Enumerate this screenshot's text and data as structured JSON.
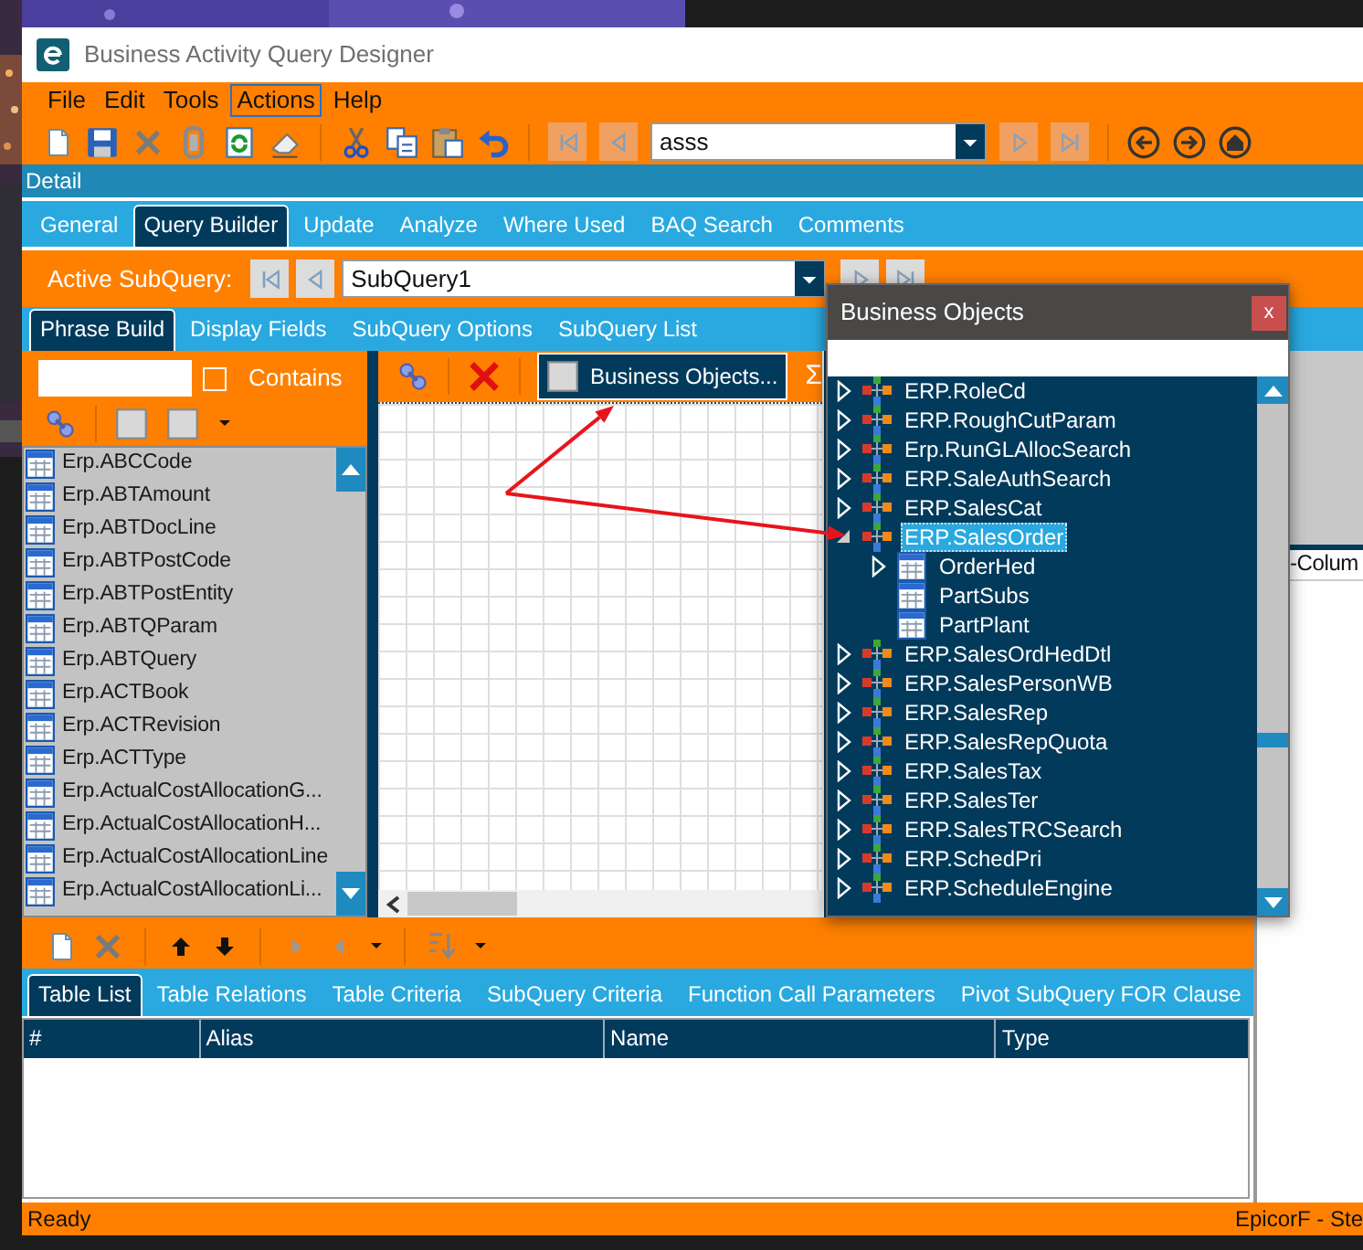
{
  "window": {
    "title": "Business Activity Query Designer"
  },
  "menu": [
    {
      "label": "File",
      "selected": false
    },
    {
      "label": "Edit",
      "selected": false
    },
    {
      "label": "Tools",
      "selected": false
    },
    {
      "label": "Actions",
      "selected": true
    },
    {
      "label": "Help",
      "selected": false
    }
  ],
  "toolbar": {
    "record_field": {
      "value": "asss"
    }
  },
  "detail_panel": {
    "title": "Detail"
  },
  "tabs": [
    {
      "label": "General",
      "selected": false
    },
    {
      "label": "Query Builder",
      "selected": true
    },
    {
      "label": "Update",
      "selected": false
    },
    {
      "label": "Analyze",
      "selected": false
    },
    {
      "label": "Where Used",
      "selected": false
    },
    {
      "label": "BAQ Search",
      "selected": false
    },
    {
      "label": "Comments",
      "selected": false
    }
  ],
  "active_subquery": {
    "label": "Active SubQuery:",
    "value": "SubQuery1"
  },
  "subquery_tabs": [
    {
      "label": "Phrase Build",
      "selected": true
    },
    {
      "label": "Display Fields",
      "selected": false
    },
    {
      "label": "SubQuery Options",
      "selected": false
    },
    {
      "label": "SubQuery List",
      "selected": false
    }
  ],
  "table_filter": {
    "contains_label": "Contains",
    "contains_checked": false
  },
  "tables": [
    "Erp.ABCCode",
    "Erp.ABTAmount",
    "Erp.ABTDocLine",
    "Erp.ABTPostCode",
    "Erp.ABTPostEntity",
    "Erp.ABTQParam",
    "Erp.ABTQuery",
    "Erp.ACTBook",
    "Erp.ACTRevision",
    "Erp.ACTType",
    "Erp.ActualCostAllocationG...",
    "Erp.ActualCostAllocationH...",
    "Erp.ActualCostAllocationLine",
    "Erp.ActualCostAllocationLi..."
  ],
  "canvas_toolbar": {
    "business_objects_button": "Business Objects...",
    "sum_symbol": "Σ"
  },
  "business_objects": {
    "title": "Business Objects",
    "close": "x",
    "items": [
      {
        "name": "ERP.RoleCd",
        "expanded": false,
        "selected": false
      },
      {
        "name": "ERP.RoughCutParam",
        "expanded": false,
        "selected": false
      },
      {
        "name": "Erp.RunGLAllocSearch",
        "expanded": false,
        "selected": false
      },
      {
        "name": "ERP.SaleAuthSearch",
        "expanded": false,
        "selected": false
      },
      {
        "name": "ERP.SalesCat",
        "expanded": false,
        "selected": false
      },
      {
        "name": "ERP.SalesOrder",
        "expanded": true,
        "selected": true,
        "children": [
          {
            "name": "OrderHed",
            "expandable": true
          },
          {
            "name": "PartSubs",
            "expandable": false
          },
          {
            "name": "PartPlant",
            "expandable": false
          }
        ]
      },
      {
        "name": "ERP.SalesOrdHedDtl",
        "expanded": false,
        "selected": false
      },
      {
        "name": "ERP.SalesPersonWB",
        "expanded": false,
        "selected": false
      },
      {
        "name": "ERP.SalesRep",
        "expanded": false,
        "selected": false
      },
      {
        "name": "ERP.SalesRepQuota",
        "expanded": false,
        "selected": false
      },
      {
        "name": "ERP.SalesTax",
        "expanded": false,
        "selected": false
      },
      {
        "name": "ERP.SalesTer",
        "expanded": false,
        "selected": false
      },
      {
        "name": "ERP.SalesTRCSearch",
        "expanded": false,
        "selected": false
      },
      {
        "name": "ERP.SchedPri",
        "expanded": false,
        "selected": false
      },
      {
        "name": "ERP.ScheduleEngine",
        "expanded": false,
        "selected": false
      }
    ]
  },
  "lower_tabs": [
    {
      "label": "Table List",
      "selected": true
    },
    {
      "label": "Table Relations",
      "selected": false
    },
    {
      "label": "Table Criteria",
      "selected": false
    },
    {
      "label": "SubQuery Criteria",
      "selected": false
    },
    {
      "label": "Function Call Parameters",
      "selected": false
    },
    {
      "label": "Pivot SubQuery FOR Clause",
      "selected": false
    }
  ],
  "table_list": {
    "columns": [
      "#",
      "Alias",
      "Name",
      "Type"
    ]
  },
  "right_panel": {
    "column_header": "-Colum"
  },
  "status_bar": {
    "left": "Ready",
    "right": "EpicorF - Ste"
  }
}
